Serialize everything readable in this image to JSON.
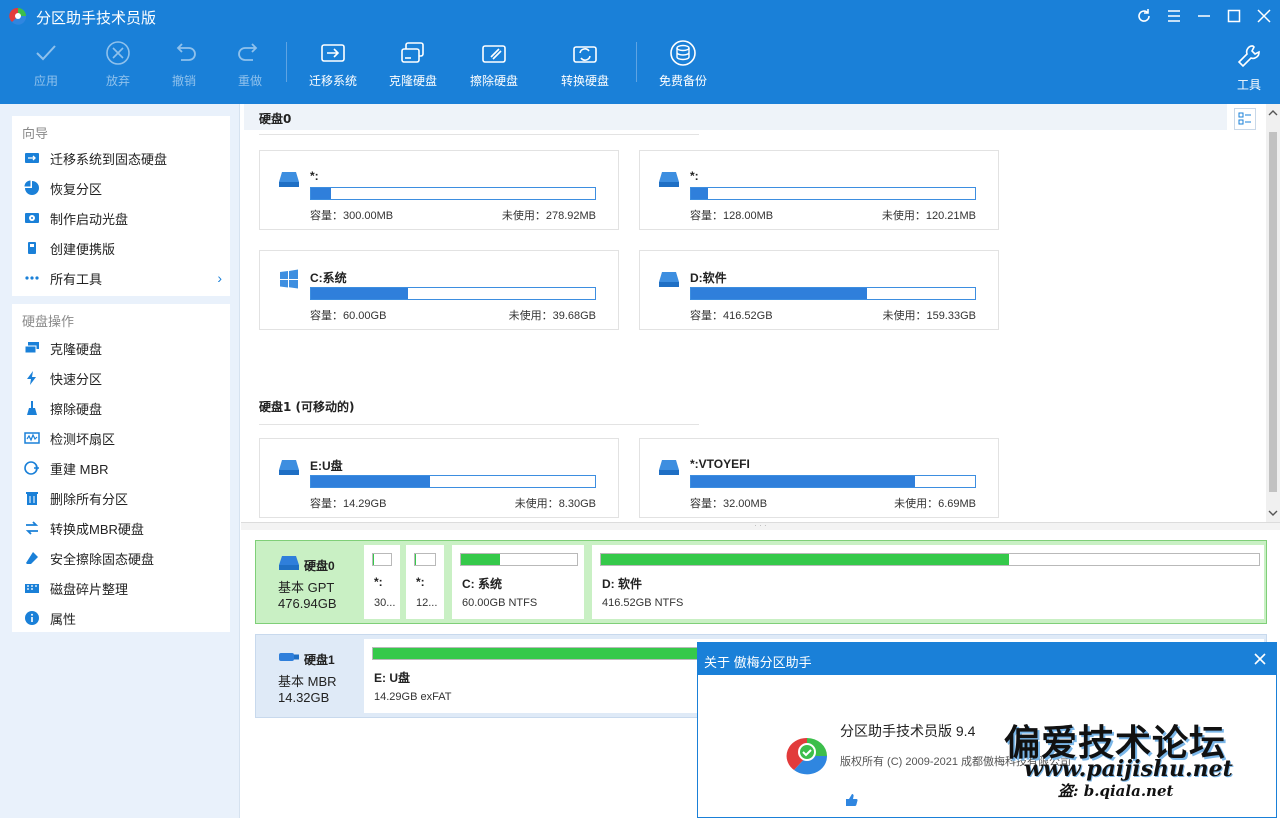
{
  "app": {
    "title": "分区助手技术员版"
  },
  "toolbar": {
    "apply": "应用",
    "discard": "放弃",
    "undo": "撤销",
    "redo": "重做",
    "migrate": "迁移系统",
    "clone": "克隆硬盘",
    "wipe": "擦除硬盘",
    "convert": "转换硬盘",
    "backup": "免费备份",
    "tools": "工具"
  },
  "sidebar": {
    "wizard_title": "向导",
    "wizard_items": [
      {
        "label": "迁移系统到固态硬盘",
        "icon": "migrate-icon"
      },
      {
        "label": "恢复分区",
        "icon": "pie-icon"
      },
      {
        "label": "制作启动光盘",
        "icon": "boot-disc-icon"
      },
      {
        "label": "创建便携版",
        "icon": "portable-icon"
      },
      {
        "label": "所有工具",
        "icon": "more-icon"
      }
    ],
    "disk_ops_title": "硬盘操作",
    "disk_ops_items": [
      {
        "label": "克隆硬盘",
        "icon": "clone-icon"
      },
      {
        "label": "快速分区",
        "icon": "lightning-icon"
      },
      {
        "label": "擦除硬盘",
        "icon": "broom-icon"
      },
      {
        "label": "检测坏扇区",
        "icon": "scan-icon"
      },
      {
        "label": "重建 MBR",
        "icon": "rebuild-icon"
      },
      {
        "label": "删除所有分区",
        "icon": "trash-icon"
      },
      {
        "label": "转换成MBR硬盘",
        "icon": "convert-icon"
      },
      {
        "label": "安全擦除固态硬盘",
        "icon": "eraser-icon"
      },
      {
        "label": "磁盘碎片整理",
        "icon": "defrag-icon"
      },
      {
        "label": "属性",
        "icon": "info-icon"
      }
    ]
  },
  "upper": {
    "disk0_heading": "硬盘0",
    "disk1_heading": "硬盘1 (可移动的)",
    "cap_label": "容量：",
    "free_label": "未使用：",
    "disk0_partitions": [
      {
        "name": "*:",
        "capacity": "300.00MB",
        "free": "278.92MB",
        "used_pct": 7,
        "icon": "drive-icon"
      },
      {
        "name": "*:",
        "capacity": "128.00MB",
        "free": "120.21MB",
        "used_pct": 6,
        "icon": "drive-icon"
      },
      {
        "name": "C:系统",
        "capacity": "60.00GB",
        "free": "39.68GB",
        "used_pct": 34,
        "icon": "windows-icon"
      },
      {
        "name": "D:软件",
        "capacity": "416.52GB",
        "free": "159.33GB",
        "used_pct": 62,
        "icon": "drive-icon"
      }
    ],
    "disk1_partitions": [
      {
        "name": "E:U盘",
        "capacity": "14.29GB",
        "free": "8.30GB",
        "used_pct": 42,
        "icon": "drive-icon"
      },
      {
        "name": "*:VTOYEFI",
        "capacity": "32.00MB",
        "free": "6.69MB",
        "used_pct": 79,
        "icon": "drive-icon"
      }
    ]
  },
  "lower": {
    "disk0": {
      "name": "硬盘0",
      "type": "基本 GPT",
      "size": "476.94GB",
      "parts": [
        {
          "name": "*:",
          "info": "30...",
          "used_pct": 7
        },
        {
          "name": "*:",
          "info": "12...",
          "used_pct": 6
        },
        {
          "name": "C: 系统",
          "info": "60.00GB NTFS",
          "used_pct": 34
        },
        {
          "name": "D: 软件",
          "info": "416.52GB NTFS",
          "used_pct": 62
        }
      ]
    },
    "disk1": {
      "name": "硬盘1",
      "type": "基本 MBR",
      "size": "14.32GB",
      "parts": [
        {
          "name": "E: U盘",
          "info": "14.29GB exFAT",
          "used_pct": 42
        }
      ]
    }
  },
  "about": {
    "title": "关于 傲梅分区助手",
    "product": "分区助手技术员版 9.4",
    "copyright": "版权所有 (C) 2009-2021 成都傲梅科技有限公司"
  },
  "watermark": {
    "line1": "偏爱技术论坛",
    "line2": "www.paijishu.net",
    "line3": "b.qiala.net",
    "prefix": "盗"
  },
  "colors": {
    "accent": "#1a80d8",
    "used_bar": "#2f7fdb",
    "map_bar": "#35c94a"
  }
}
